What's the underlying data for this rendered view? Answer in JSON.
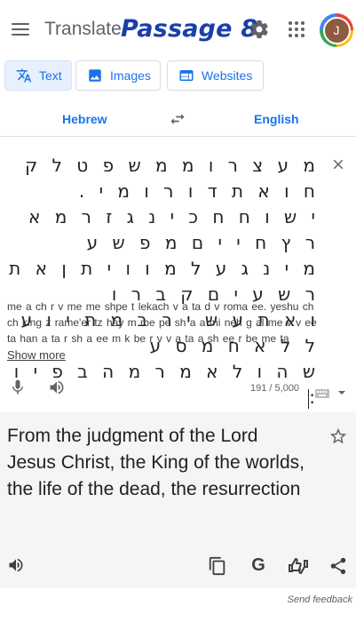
{
  "header": {
    "app_title": "Translate",
    "overlay_title": "Passage 8",
    "avatar_initial": "J",
    "colors": {
      "overlay_title": "#1a3fa8",
      "accent": "#1a73e8"
    }
  },
  "modes": [
    {
      "label": "Text",
      "icon": "translate-icon",
      "active": true
    },
    {
      "label": "Images",
      "icon": "image-icon",
      "active": false
    },
    {
      "label": "Websites",
      "icon": "website-icon",
      "active": false
    }
  ],
  "languages": {
    "source": "Hebrew",
    "target": "English"
  },
  "source": {
    "text_lines": [
      "מ ע צ ר ו מ מ ש פ ט ל ק ח ו א ת ד ו ר ו מ י .",
      "י ש ו ח ח כ י נ ג ז ר מ א ר ץ ח י י ם מ פ ש ע",
      "מ י נ ג ע ל מ ו ו י ת ן א ת ר ש ע י ם ק ב ר ו",
      "ו א ת ע ש י ר ב מ ת י ו ע ל ל א ח מ ס ע",
      "ש ה ו ל א מ ר מ ה ב פ י ו :"
    ],
    "transliteration": "me a ch r v me me shpe t lekach v a ta d v roma ee. yeshu ch ch king z rame'er tz hay m me pe sh a a mi neh g al me v v ee ta han a ta r sh a ee m k be r v v a ta a sh ee r be me ta",
    "show_more": "Show more",
    "char_count": "191 / 5,000"
  },
  "target": {
    "text": "From the judgment of the Lord Jesus Christ, the King of the worlds, the life of the dead, the resurrection"
  },
  "footer": {
    "feedback": "Send feedback"
  }
}
